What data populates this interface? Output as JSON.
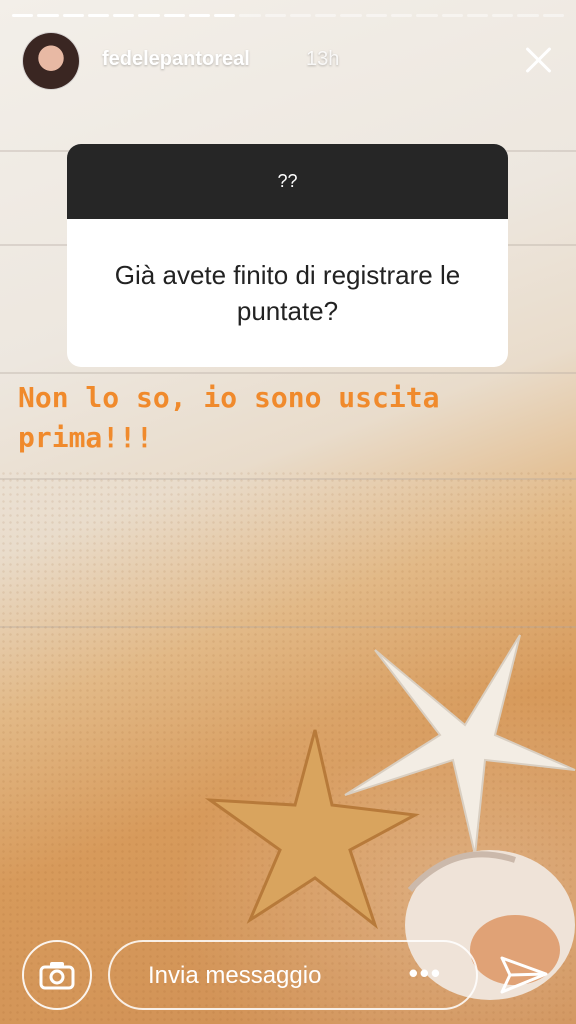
{
  "progress": {
    "segments": 22,
    "completed": 9
  },
  "header": {
    "username": "fedelepantoreal",
    "time": "13h"
  },
  "question": {
    "title": "??",
    "text": "Già avete finito di registrare le puntate?"
  },
  "answer": {
    "text": "Non lo so, io sono uscita prima!!!"
  },
  "footer": {
    "message_placeholder": "Invia messaggio",
    "more": "•••"
  },
  "colors": {
    "answer_text": "#f08a2c",
    "card_header": "#262626"
  },
  "icons": [
    "camera-icon",
    "close-icon",
    "more-icon",
    "send-icon"
  ]
}
